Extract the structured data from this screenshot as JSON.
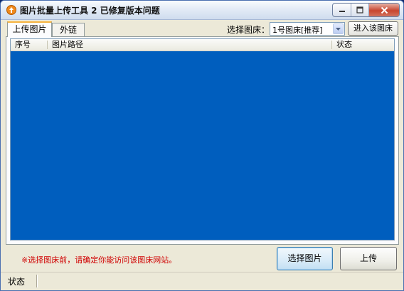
{
  "window": {
    "title": "图片批量上传工具 2 已修复版本问题",
    "controls": {
      "minimize": "minimize-icon",
      "maximize": "maximize-icon",
      "close": "close-icon"
    }
  },
  "tabs": [
    {
      "label": "上传图片",
      "active": true
    },
    {
      "label": "外链",
      "active": false
    }
  ],
  "host_picker": {
    "label": "选择图床：",
    "selected": "1号图床[推荐]",
    "enter_button": "进入该图床"
  },
  "list": {
    "columns": [
      "序号",
      "图片路径",
      "状态"
    ],
    "rows": [],
    "background": "#005ebe"
  },
  "notice": "※选择图床前，请确定你能访问该图床网站。",
  "buttons": {
    "select_images": "选择图片",
    "upload": "上传"
  },
  "statusbar": {
    "label": "状态"
  },
  "colors": {
    "accent": "#f7b33f",
    "notice": "#d00000",
    "close_button": "#c8452f"
  }
}
